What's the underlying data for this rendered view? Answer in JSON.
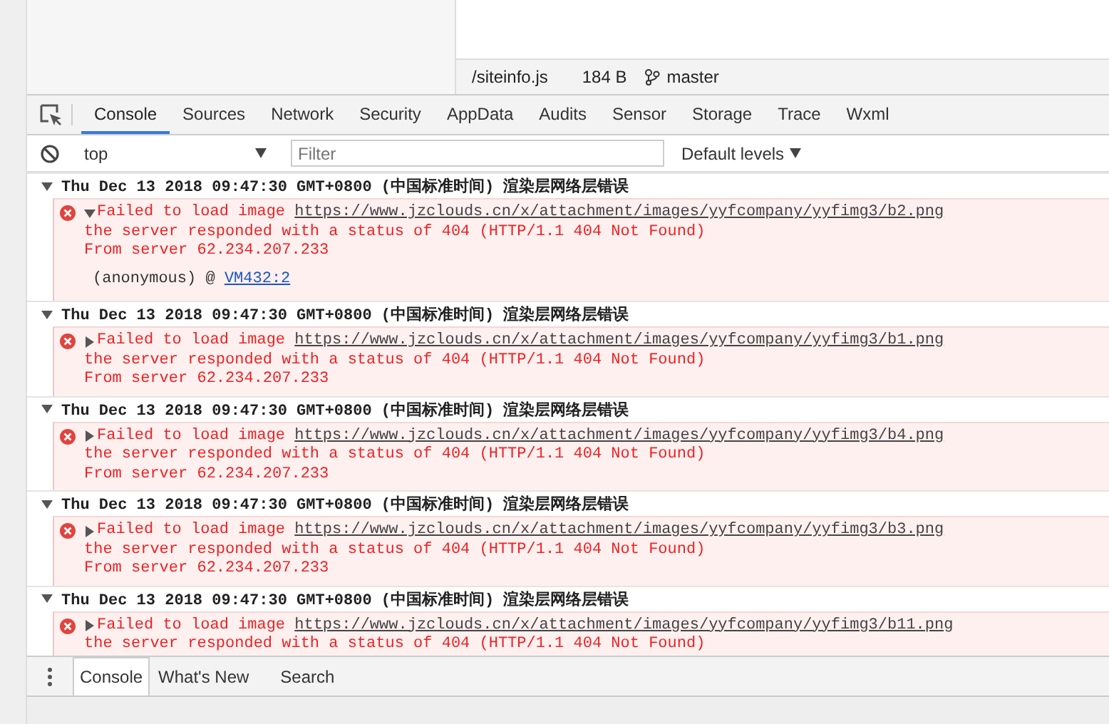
{
  "status_bar": {
    "file": "/siteinfo.js",
    "size": "184 B",
    "branch": "master"
  },
  "tabs": [
    {
      "label": "Console",
      "selected": true
    },
    {
      "label": "Sources",
      "selected": false
    },
    {
      "label": "Network",
      "selected": false
    },
    {
      "label": "Security",
      "selected": false
    },
    {
      "label": "AppData",
      "selected": false
    },
    {
      "label": "Audits",
      "selected": false
    },
    {
      "label": "Sensor",
      "selected": false
    },
    {
      "label": "Storage",
      "selected": false
    },
    {
      "label": "Trace",
      "selected": false
    },
    {
      "label": "Wxml",
      "selected": false
    }
  ],
  "toolbar": {
    "context": "top",
    "filter_placeholder": "Filter",
    "levels": "Default levels"
  },
  "log_groups": [
    {
      "expanded": true,
      "header": "Thu Dec 13 2018 09:47:30 GMT+0800 (中国标准时间) 渲染层网络层错误",
      "error": {
        "expanded": true,
        "message": "Failed to load image",
        "url": "https://www.jzclouds.cn/x/attachment/images/yyfcompany/yyfimg3/b2.png",
        "lines": [
          "the server responded with a status of 404 (HTTP/1.1 404 Not Found)",
          "From server 62.234.207.233"
        ],
        "stack": {
          "function": "(anonymous) @",
          "link": "VM432:2"
        }
      }
    },
    {
      "expanded": true,
      "header": "Thu Dec 13 2018 09:47:30 GMT+0800 (中国标准时间) 渲染层网络层错误",
      "error": {
        "expanded": false,
        "message": "Failed to load image",
        "url": "https://www.jzclouds.cn/x/attachment/images/yyfcompany/yyfimg3/b1.png",
        "lines": [
          "the server responded with a status of 404 (HTTP/1.1 404 Not Found)",
          "From server 62.234.207.233"
        ]
      }
    },
    {
      "expanded": true,
      "header": "Thu Dec 13 2018 09:47:30 GMT+0800 (中国标准时间) 渲染层网络层错误",
      "error": {
        "expanded": false,
        "message": "Failed to load image",
        "url": "https://www.jzclouds.cn/x/attachment/images/yyfcompany/yyfimg3/b4.png",
        "lines": [
          "the server responded with a status of 404 (HTTP/1.1 404 Not Found)",
          "From server 62.234.207.233"
        ]
      }
    },
    {
      "expanded": true,
      "header": "Thu Dec 13 2018 09:47:30 GMT+0800 (中国标准时间) 渲染层网络层错误",
      "error": {
        "expanded": false,
        "message": "Failed to load image",
        "url": "https://www.jzclouds.cn/x/attachment/images/yyfcompany/yyfimg3/b3.png",
        "lines": [
          "the server responded with a status of 404 (HTTP/1.1 404 Not Found)",
          "From server 62.234.207.233"
        ]
      }
    },
    {
      "expanded": true,
      "header": "Thu Dec 13 2018 09:47:30 GMT+0800 (中国标准时间) 渲染层网络层错误",
      "error": {
        "expanded": false,
        "message": "Failed to load image",
        "url": "https://www.jzclouds.cn/x/attachment/images/yyfcompany/yyfimg3/b11.png",
        "lines": [
          "the server responded with a status of 404 (HTTP/1.1 404 Not Found)"
        ]
      }
    }
  ],
  "drawer_tabs": [
    {
      "label": "Console",
      "selected": true
    },
    {
      "label": "What's New",
      "selected": false
    },
    {
      "label": "Search",
      "selected": false
    }
  ]
}
